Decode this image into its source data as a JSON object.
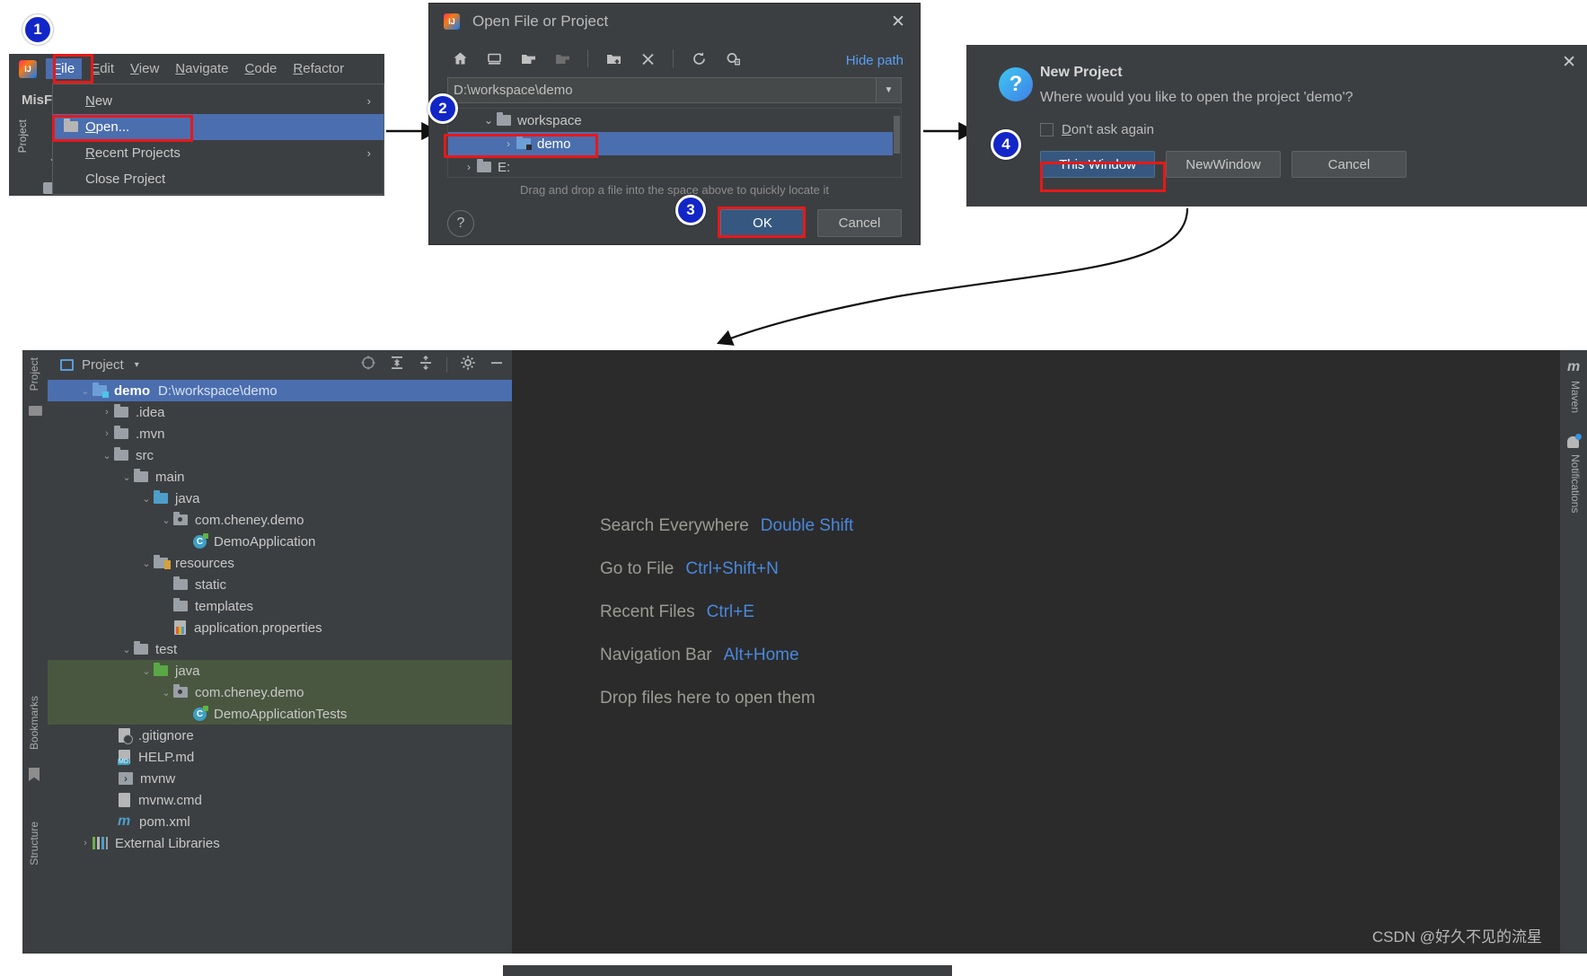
{
  "steps": {
    "one": "1",
    "two": "2",
    "three": "3",
    "four": "4"
  },
  "ide_fragment": {
    "logo": "intellij-idea-logo",
    "menus": [
      {
        "label": "File",
        "mnemonic": "F",
        "active": true
      },
      {
        "label": "Edit",
        "mnemonic": "E",
        "active": false
      },
      {
        "label": "View",
        "mnemonic": "V",
        "active": false
      },
      {
        "label": "Navigate",
        "mnemonic": "N",
        "active": false
      },
      {
        "label": "Code",
        "mnemonic": "C",
        "active": false
      },
      {
        "label": "Refactor",
        "mnemonic": "R",
        "active": false
      }
    ],
    "project_name_partial": "MisF",
    "left_tool_label": "Project"
  },
  "file_menu": {
    "items": [
      {
        "label": "New",
        "mnemonic": "N",
        "submenu": true,
        "selected": false,
        "icon": null
      },
      {
        "label": "Open...",
        "mnemonic": "O",
        "submenu": false,
        "selected": true,
        "icon": "folder-open-icon"
      },
      {
        "label": "Recent Projects",
        "mnemonic": "R",
        "submenu": true,
        "selected": false,
        "icon": null
      },
      {
        "label": "Close Project",
        "mnemonic": "",
        "submenu": false,
        "selected": false,
        "icon": null
      }
    ],
    "submenu_arrow": "›"
  },
  "open_dialog": {
    "title": "Open File or Project",
    "close_icon": "close-icon",
    "toolbar": [
      {
        "name": "home-icon",
        "glyph": "home"
      },
      {
        "name": "desktop-icon",
        "glyph": "desktop"
      },
      {
        "name": "project-folder-icon",
        "glyph": "folder-project"
      },
      {
        "name": "module-folder-icon",
        "glyph": "folder-module"
      },
      {
        "name": "new-folder-icon",
        "glyph": "folder-plus"
      },
      {
        "name": "delete-icon",
        "glyph": "x"
      },
      {
        "name": "refresh-icon",
        "glyph": "refresh"
      },
      {
        "name": "show-hidden-icon",
        "glyph": "hidden"
      }
    ],
    "hide_path_link": "Hide path",
    "path_value": "D:\\workspace\\demo",
    "path_placeholder": "D:\\workspace\\demo",
    "dropdown_icon": "chevron-down-icon",
    "tree": [
      {
        "label": "workspace",
        "indent": 1,
        "chevron": "⌄",
        "selected": false,
        "icon": "folder"
      },
      {
        "label": "demo",
        "indent": 2,
        "chevron": "›",
        "selected": true,
        "icon": "folder-project"
      },
      {
        "label": "E:",
        "indent": 0,
        "chevron": "›",
        "selected": false,
        "icon": "folder-drive"
      }
    ],
    "drag_hint": "Drag and drop a file into the space above to quickly locate it",
    "help_label": "?",
    "ok_label": "OK",
    "cancel_label": "Cancel"
  },
  "new_project_dialog": {
    "close_icon": "close-icon",
    "question_icon": "question-icon",
    "title": "New Project",
    "message": "Where would you like to open the project 'demo'?",
    "checkbox_label": "Don't ask again",
    "checkbox_mnemonic": "D",
    "checkbox_checked": false,
    "buttons": [
      {
        "label": "This Window",
        "mnemonic": "T",
        "primary": true,
        "highlighted": true
      },
      {
        "label": "New Window",
        "mnemonic": "W",
        "primary": false,
        "highlighted": false
      },
      {
        "label": "Cancel",
        "mnemonic": "",
        "primary": false,
        "highlighted": false
      }
    ]
  },
  "ide_window": {
    "left_strip": [
      {
        "label": "Project",
        "name": "tool-button-project"
      },
      {
        "label": "Bookmarks",
        "name": "tool-button-bookmarks"
      },
      {
        "label": "Structure",
        "name": "tool-button-structure"
      }
    ],
    "right_strip": [
      {
        "label": "Maven",
        "name": "tool-button-maven",
        "icon": "maven-icon"
      },
      {
        "label": "Notifications",
        "name": "tool-button-notifications",
        "icon": "bell-icon"
      }
    ],
    "project_panel": {
      "title": "Project",
      "view_caret": "▾",
      "tools": [
        {
          "name": "select-opened-file-icon"
        },
        {
          "name": "expand-all-icon"
        },
        {
          "name": "collapse-all-icon"
        },
        {
          "name": "settings-gear-icon"
        },
        {
          "name": "hide-icon"
        }
      ]
    },
    "tree": [
      {
        "label": "demo",
        "path": "D:\\workspace\\demo",
        "indent": 0,
        "chevron": "⌄",
        "icon": "project-folder",
        "state": "selected",
        "bold": true
      },
      {
        "label": ".idea",
        "path": "",
        "indent": 1,
        "chevron": "›",
        "icon": "folder",
        "state": "",
        "bold": false
      },
      {
        "label": ".mvn",
        "path": "",
        "indent": 1,
        "chevron": "›",
        "icon": "folder",
        "state": "",
        "bold": false
      },
      {
        "label": "src",
        "path": "",
        "indent": 1,
        "chevron": "⌄",
        "icon": "folder",
        "state": "",
        "bold": false
      },
      {
        "label": "main",
        "path": "",
        "indent": 2,
        "chevron": "⌄",
        "icon": "folder",
        "state": "",
        "bold": false
      },
      {
        "label": "java",
        "path": "",
        "indent": 3,
        "chevron": "⌄",
        "icon": "source-folder",
        "state": "",
        "bold": false
      },
      {
        "label": "com.cheney.demo",
        "path": "",
        "indent": 4,
        "chevron": "⌄",
        "icon": "package",
        "state": "",
        "bold": false
      },
      {
        "label": "DemoApplication",
        "path": "",
        "indent": 5,
        "chevron": "",
        "icon": "java-class",
        "state": "",
        "bold": false
      },
      {
        "label": "resources",
        "path": "",
        "indent": 3,
        "chevron": "⌄",
        "icon": "resources-folder",
        "state": "",
        "bold": false
      },
      {
        "label": "static",
        "path": "",
        "indent": 4,
        "chevron": "",
        "icon": "folder",
        "state": "",
        "bold": false
      },
      {
        "label": "templates",
        "path": "",
        "indent": 4,
        "chevron": "",
        "icon": "folder",
        "state": "",
        "bold": false
      },
      {
        "label": "application.properties",
        "path": "",
        "indent": 4,
        "chevron": "",
        "icon": "properties-file",
        "state": "",
        "bold": false
      },
      {
        "label": "test",
        "path": "",
        "indent": 2,
        "chevron": "⌄",
        "icon": "folder",
        "state": "",
        "bold": false
      },
      {
        "label": "java",
        "path": "",
        "indent": 3,
        "chevron": "⌄",
        "icon": "test-source-folder",
        "state": "green",
        "bold": false
      },
      {
        "label": "com.cheney.demo",
        "path": "",
        "indent": 4,
        "chevron": "⌄",
        "icon": "package",
        "state": "green",
        "bold": false
      },
      {
        "label": "DemoApplicationTests",
        "path": "",
        "indent": 5,
        "chevron": "",
        "icon": "java-class",
        "state": "green",
        "bold": false
      },
      {
        "label": ".gitignore",
        "path": "",
        "indent": 1,
        "chevron": "",
        "icon": "gitignore-file",
        "state": "",
        "bold": false
      },
      {
        "label": "HELP.md",
        "path": "",
        "indent": 1,
        "chevron": "",
        "icon": "markdown-file",
        "state": "",
        "bold": false
      },
      {
        "label": "mvnw",
        "path": "",
        "indent": 1,
        "chevron": "",
        "icon": "shell-file",
        "state": "",
        "bold": false
      },
      {
        "label": "mvnw.cmd",
        "path": "",
        "indent": 1,
        "chevron": "",
        "icon": "cmd-file",
        "state": "",
        "bold": false
      },
      {
        "label": "pom.xml",
        "path": "",
        "indent": 1,
        "chevron": "",
        "icon": "maven-pom-file",
        "state": "",
        "bold": false
      },
      {
        "label": "External Libraries",
        "path": "",
        "indent": 0,
        "chevron": "›",
        "icon": "libraries-icon",
        "state": "",
        "bold": false
      }
    ],
    "editor_shortcuts": [
      {
        "label": "Search Everywhere",
        "key": "Double Shift"
      },
      {
        "label": "Go to File",
        "key": "Ctrl+Shift+N"
      },
      {
        "label": "Recent Files",
        "key": "Ctrl+E"
      },
      {
        "label": "Navigation Bar",
        "key": "Alt+Home"
      },
      {
        "label": "Drop files here to open them",
        "key": ""
      }
    ],
    "watermark": "CSDN @好久不见的流星"
  },
  "colors": {
    "accent_blue": "#4b6eaf",
    "link_blue": "#589df6",
    "annotation_red": "#e81818",
    "badge_blue": "#1226c8",
    "panel_bg": "#3c3f41",
    "editor_bg": "#2b2b2b",
    "test_green": "#4a5740"
  }
}
